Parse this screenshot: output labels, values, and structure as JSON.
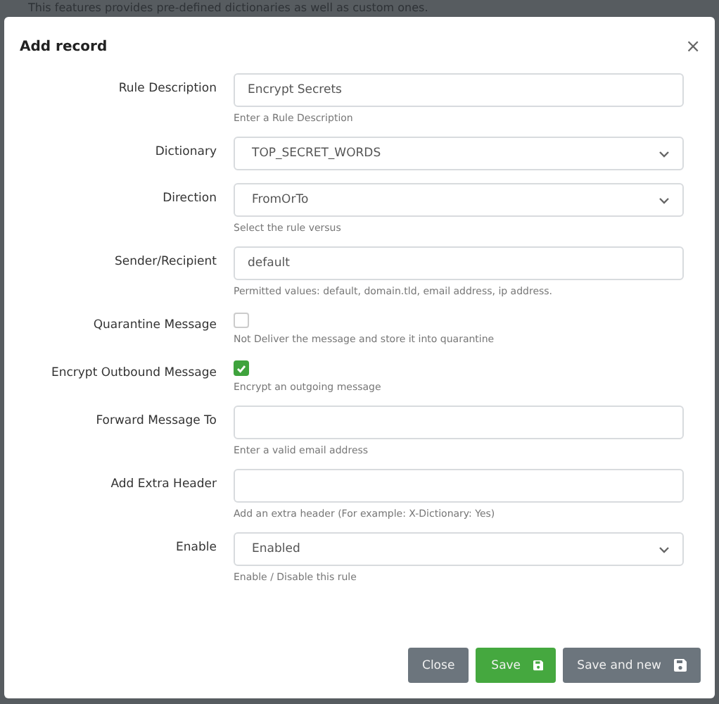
{
  "backdrop_text": "This features provides pre-defined dictionaries as well as custom ones.",
  "dialog": {
    "title": "Add record",
    "close": "×"
  },
  "fields": [
    {
      "kind": "text",
      "label": "Rule Description",
      "value": "Encrypt Secrets",
      "help": "Enter a Rule Description"
    },
    {
      "kind": "select",
      "label": "Dictionary",
      "value": "TOP_SECRET_WORDS"
    },
    {
      "kind": "select",
      "label": "Direction",
      "value": "FromOrTo",
      "help": "Select the rule versus"
    },
    {
      "kind": "text",
      "label": "Sender/Recipient",
      "value": "default",
      "help": "Permitted values: default, domain.tld, email address, ip address."
    },
    {
      "kind": "checkbox",
      "label": "Quarantine Message",
      "checked": false,
      "help": "Not Deliver the message and store it into quarantine"
    },
    {
      "kind": "checkbox",
      "label": "Encrypt Outbound Message",
      "checked": true,
      "help": "Encrypt an outgoing message"
    },
    {
      "kind": "text",
      "label": "Forward Message To",
      "help": "Enter a valid email address"
    },
    {
      "kind": "text",
      "label": "Add Extra Header",
      "help": "Add an extra header (For example: X-Dictionary: Yes)"
    },
    {
      "kind": "select",
      "label": "Enable",
      "value": "Enabled",
      "help": "Enable / Disable this rule"
    }
  ],
  "buttons": [
    {
      "kind": "close",
      "label": "Close"
    },
    {
      "kind": "save",
      "label": "Save"
    },
    {
      "kind": "save_new",
      "label": "Save and new"
    }
  ]
}
